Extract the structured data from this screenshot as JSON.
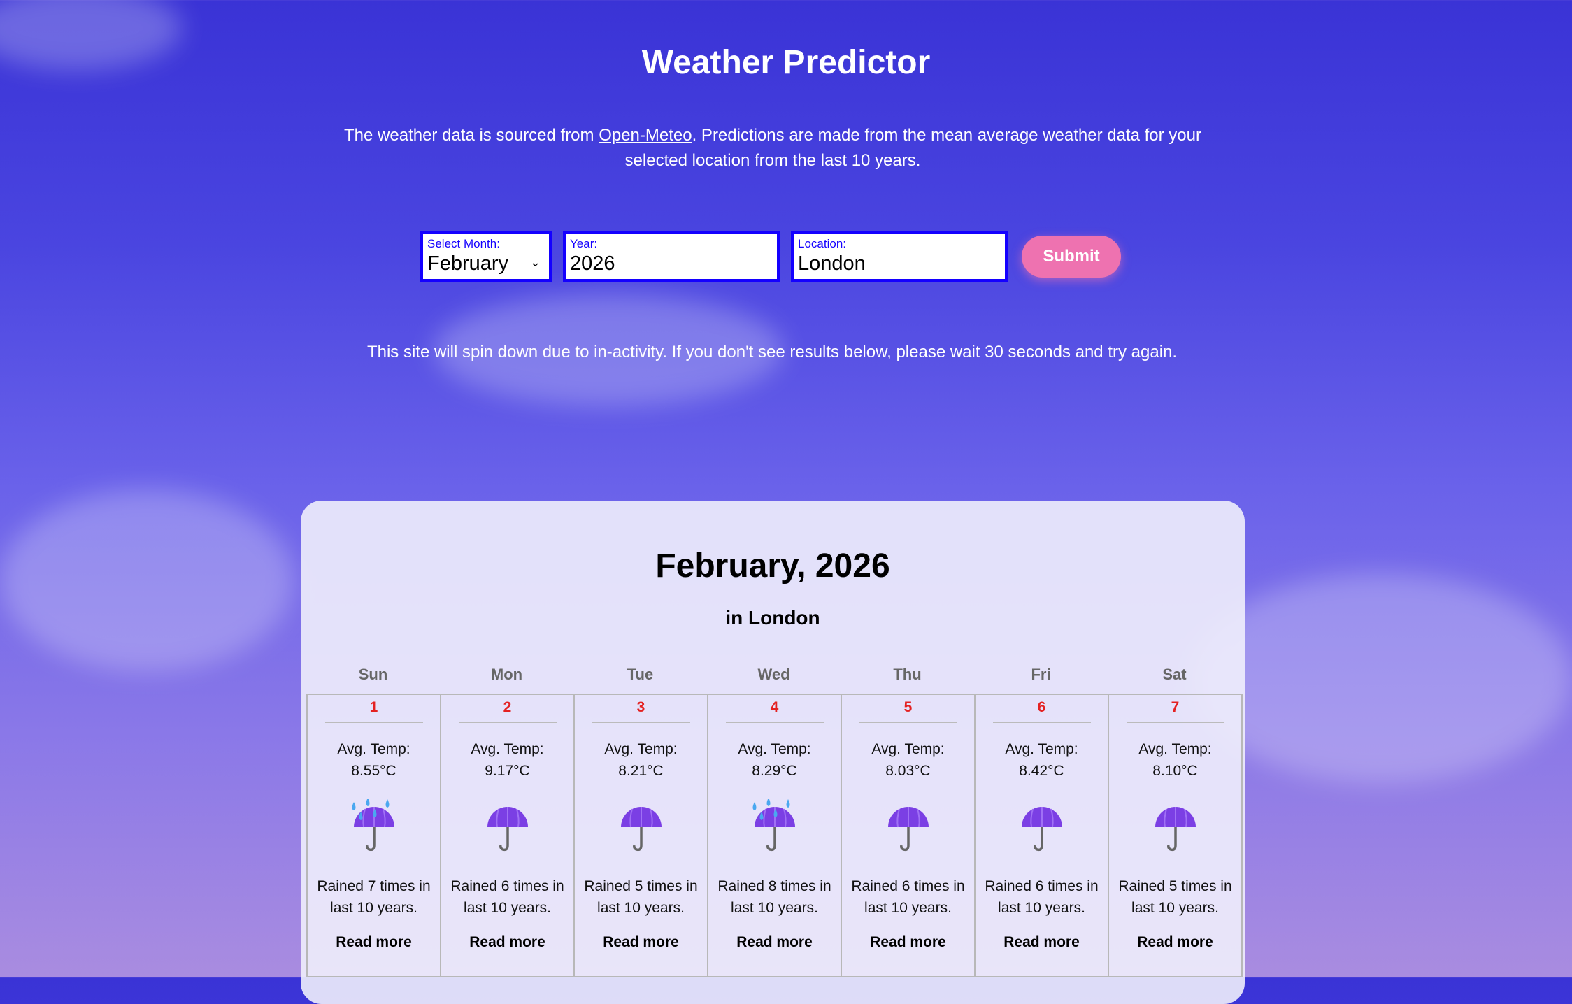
{
  "title": "Weather Predictor",
  "intro": {
    "pre": "The weather data is sourced from ",
    "link": "Open-Meteo",
    "post": ". Predictions are made from the mean average weather data for your selected location from the last 10 years."
  },
  "form": {
    "month_label": "Select Month:",
    "month_value": "February",
    "year_label": "Year:",
    "year_value": "2026",
    "location_label": "Location:",
    "location_value": "London",
    "submit": "Submit"
  },
  "note": "This site will spin down due to in-activity. If you don't see results below, please wait 30 seconds and try again.",
  "calendar": {
    "title": "February, 2026",
    "subtitle": "in London",
    "weekdays": [
      "Sun",
      "Mon",
      "Tue",
      "Wed",
      "Thu",
      "Fri",
      "Sat"
    ],
    "days": [
      {
        "day": "1",
        "temp_label": "Avg. Temp:",
        "temp": "8.55°C",
        "icon": "umbrella-rain",
        "rain": "Rained 7 times in last 10 years.",
        "more": "Read more"
      },
      {
        "day": "2",
        "temp_label": "Avg. Temp:",
        "temp": "9.17°C",
        "icon": "umbrella",
        "rain": "Rained 6 times in last 10 years.",
        "more": "Read more"
      },
      {
        "day": "3",
        "temp_label": "Avg. Temp:",
        "temp": "8.21°C",
        "icon": "umbrella",
        "rain": "Rained 5 times in last 10 years.",
        "more": "Read more"
      },
      {
        "day": "4",
        "temp_label": "Avg. Temp:",
        "temp": "8.29°C",
        "icon": "umbrella-rain",
        "rain": "Rained 8 times in last 10 years.",
        "more": "Read more"
      },
      {
        "day": "5",
        "temp_label": "Avg. Temp:",
        "temp": "8.03°C",
        "icon": "umbrella",
        "rain": "Rained 6 times in last 10 years.",
        "more": "Read more"
      },
      {
        "day": "6",
        "temp_label": "Avg. Temp:",
        "temp": "8.42°C",
        "icon": "umbrella",
        "rain": "Rained 6 times in last 10 years.",
        "more": "Read more"
      },
      {
        "day": "7",
        "temp_label": "Avg. Temp:",
        "temp": "8.10°C",
        "icon": "umbrella",
        "rain": "Rained 5 times in last 10 years.",
        "more": "Read more"
      }
    ]
  }
}
